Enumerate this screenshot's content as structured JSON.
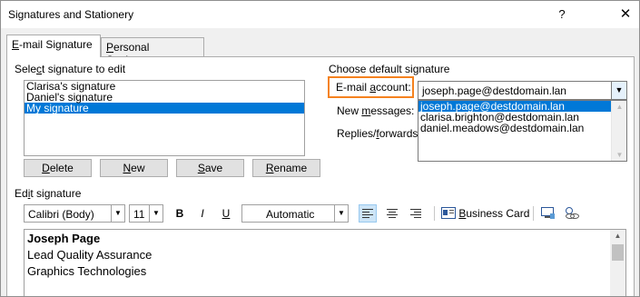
{
  "window": {
    "title": "Signatures and Stationery",
    "help_glyph": "?",
    "close_glyph": "✕"
  },
  "tabs": [
    {
      "label_pre": "",
      "label_u": "E",
      "label_post": "-mail Signature"
    },
    {
      "label_pre": "",
      "label_u": "P",
      "label_post": "ersonal Stationery"
    }
  ],
  "select_signature": {
    "label_pre": "Sele",
    "label_u": "c",
    "label_post": "t signature to edit",
    "items": [
      "Clarisa's signature",
      "Daniel's signature",
      "My signature"
    ],
    "selected_index": 2
  },
  "buttons": [
    {
      "pre": "",
      "u": "D",
      "post": "elete"
    },
    {
      "pre": "",
      "u": "N",
      "post": "ew"
    },
    {
      "pre": "",
      "u": "S",
      "post": "ave"
    },
    {
      "pre": "",
      "u": "R",
      "post": "ename"
    }
  ],
  "default_signature": {
    "label": "Choose default signature",
    "email_label_pre": "E-mail ",
    "email_label_u": "a",
    "email_label_post": "ccount:",
    "email_value": "joseph.page@destdomain.lan",
    "email_options": [
      "joseph.page@destdomain.lan",
      "clarisa.brighton@destdomain.lan",
      "daniel.meadows@destdomain.lan"
    ],
    "new_messages_pre": "New ",
    "new_messages_u": "m",
    "new_messages_post": "essages:",
    "replies_pre": "Replies/",
    "replies_u": "f",
    "replies_post": "orwards:"
  },
  "edit_signature": {
    "label_pre": "Ed",
    "label_u": "i",
    "label_post": "t signature",
    "font": "Calibri (Body)",
    "size": "11",
    "bold": "B",
    "italic": "I",
    "underline": "U",
    "color": "Automatic",
    "business_card_pre": "",
    "business_card_u": "B",
    "business_card_post": "usiness Card",
    "lines": [
      "Joseph Page",
      "Lead Quality Assurance",
      "Graphics Technologies"
    ]
  },
  "icons": {
    "align_left": "align-left-icon",
    "align_center": "align-center-icon",
    "align_right": "align-right-icon",
    "business_card": "business-card-icon",
    "picture": "insert-picture-icon",
    "hyperlink": "insert-hyperlink-icon"
  },
  "colors": {
    "selection": "#0078d7",
    "highlight_border": "#f5821f",
    "active_format": "#cce4f7"
  }
}
